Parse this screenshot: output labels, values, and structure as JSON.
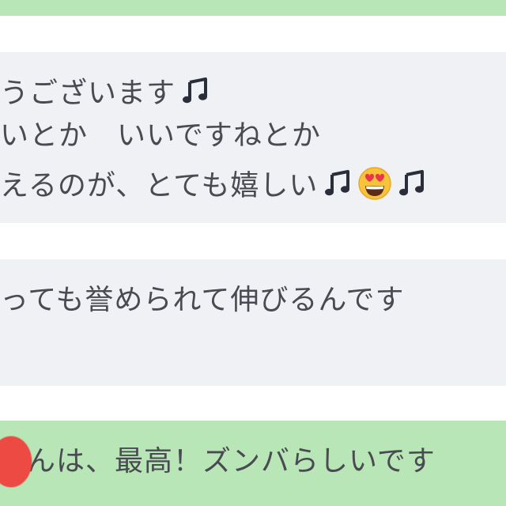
{
  "chat": {
    "messages": [
      {
        "lines": [
          "うございます",
          "いとか　いいですねとか",
          "えるのが、とても嬉しい"
        ]
      },
      {
        "lines": [
          "っても誉められて伸びるんです"
        ]
      },
      {
        "lines": [
          "んは、最高！ズンバらしいです"
        ]
      }
    ]
  },
  "icons": {
    "music_note": "music-note-icon",
    "heart_eyes": "heart-eyes-emoji-icon",
    "record": "red-circle-icon"
  },
  "colors": {
    "outgoing_bubble": "#b8e6b6",
    "incoming_bubble": "#f0f1f4",
    "text": "#4a4b52",
    "record_dot": "#ee4a44"
  }
}
